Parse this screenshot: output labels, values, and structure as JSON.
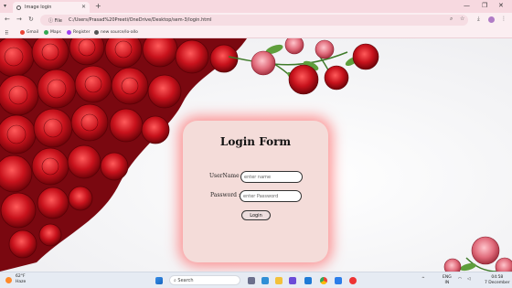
{
  "browser": {
    "tab_title": "Image login",
    "address_chip": "File",
    "url": "C:/Users/Prasad%20Preeti/OneDrive/Desktop/sem-3/login.html",
    "bookmarks": [
      "Gmail",
      "Maps",
      "Register",
      "new source/lo-allo"
    ]
  },
  "login": {
    "title": "Login Form",
    "username_label": "UserName :-",
    "username_placeholder": "enter name",
    "password_label": "Password :-",
    "password_placeholder": "enter Password",
    "button_label": "Login"
  },
  "taskbar": {
    "weather_temp": "62°F",
    "weather_desc": "Haze",
    "search_placeholder": "Search",
    "lang_line1": "ENG",
    "lang_line2": "IN",
    "time": "04:58",
    "date": "7 December"
  },
  "colors": {
    "card_bg": "#f4dcd9",
    "card_glow": "#ff4646",
    "rose_red": "#c8121c"
  }
}
